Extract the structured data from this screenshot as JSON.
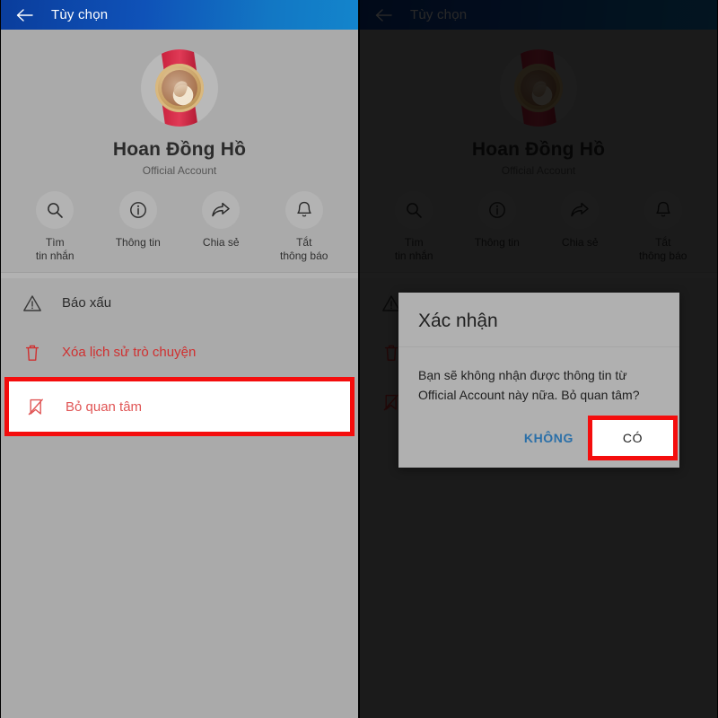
{
  "header": {
    "back_icon": "back-arrow-icon",
    "title": "Tùy chọn"
  },
  "profile": {
    "avatar_icon": "watch-avatar",
    "name": "Hoan Đồng Hồ",
    "subtitle": "Official Account"
  },
  "actions": [
    {
      "icon": "search-icon",
      "label": "Tìm\ntin nhắn"
    },
    {
      "icon": "info-icon",
      "label": "Thông tin"
    },
    {
      "icon": "share-icon",
      "label": "Chia sẻ"
    },
    {
      "icon": "bell-icon",
      "label": "Tắt\nthông báo"
    }
  ],
  "menu": [
    {
      "icon": "warning-triangle-icon",
      "label": "Báo xấu",
      "style": "normal"
    },
    {
      "icon": "trash-icon",
      "label": "Xóa lịch sử trò chuyện",
      "style": "danger"
    },
    {
      "icon": "bookmark-slash-icon",
      "label": "Bỏ quan tâm",
      "style": "danger-highlight"
    }
  ],
  "dialog": {
    "title": "Xác nhận",
    "body": "Bạn sẽ không nhận được thông tin từ Official Account này nữa. Bỏ quan tâm?",
    "cancel_label": "KHÔNG",
    "confirm_label": "CÓ"
  },
  "colors": {
    "header_blue": "#0f52b8",
    "panel_gray": "#aaaaaa",
    "danger_red": "#d03030",
    "highlight_red": "#f40d0d",
    "link_blue": "#2a6fa8",
    "dialog_gray": "#b0b0b0"
  }
}
